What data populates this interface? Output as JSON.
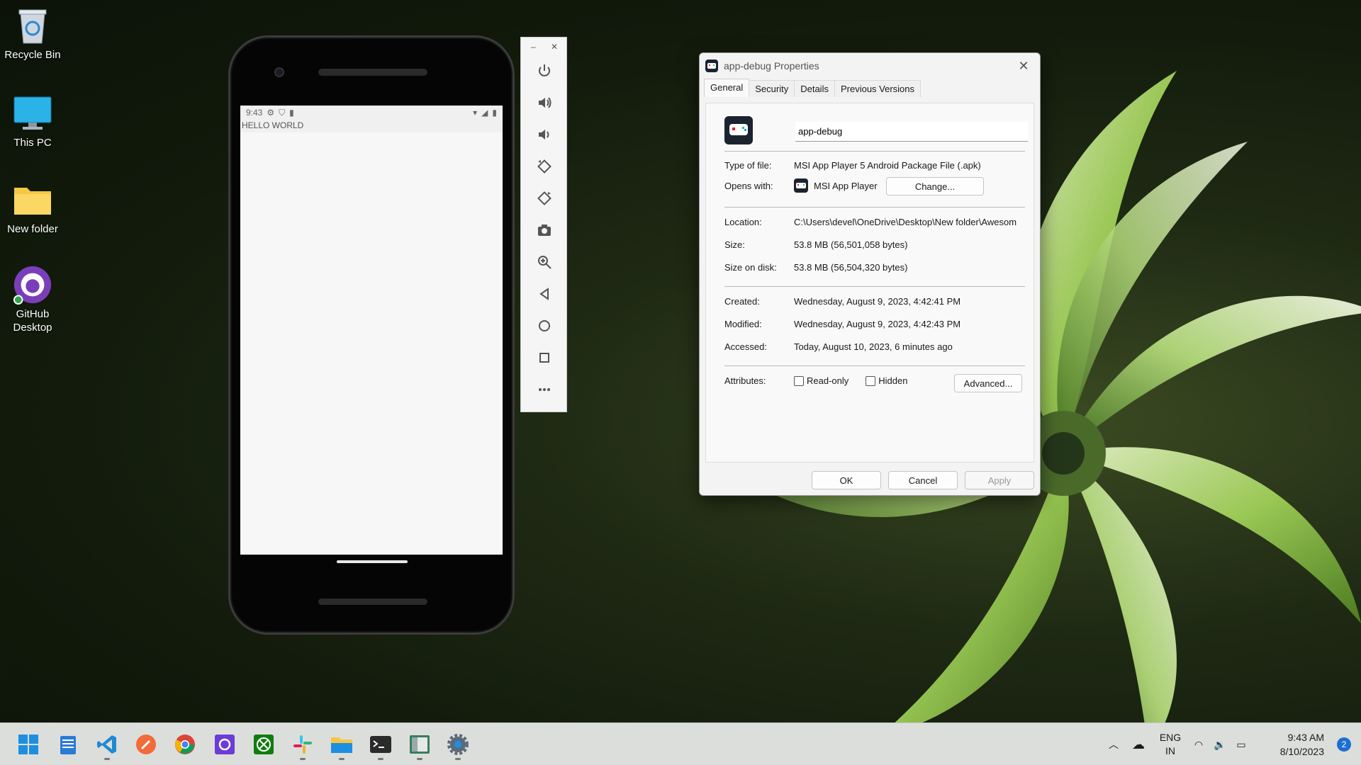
{
  "desktop": {
    "icons": [
      {
        "label": "Recycle Bin"
      },
      {
        "label": "This PC"
      },
      {
        "label": "New folder"
      },
      {
        "label": "GitHub\nDesktop"
      }
    ]
  },
  "phone": {
    "status_time": "9:43",
    "app_text": "HELLO WORLD"
  },
  "emulator_bar": {
    "minimize": "–",
    "close": "✕",
    "buttons": [
      "power",
      "volume-up",
      "volume-down",
      "rotate-left",
      "rotate-right",
      "screenshot",
      "zoom",
      "back",
      "home",
      "overview",
      "more"
    ]
  },
  "dialog": {
    "title": "app-debug Properties",
    "tabs": [
      "General",
      "Security",
      "Details",
      "Previous Versions"
    ],
    "file_name": "app-debug",
    "type_label": "Type of file:",
    "type_value": "MSI App Player 5 Android Package File (.apk)",
    "opens_label": "Opens with:",
    "opens_value": "MSI App Player",
    "change_button": "Change...",
    "location_label": "Location:",
    "location_value": "C:\\Users\\devel\\OneDrive\\Desktop\\New folder\\Awesom",
    "size_label": "Size:",
    "size_value": "53.8 MB (56,501,058 bytes)",
    "size_disk_label": "Size on disk:",
    "size_disk_value": "53.8 MB (56,504,320 bytes)",
    "created_label": "Created:",
    "created_value": "Wednesday, August 9, 2023, 4:42:41 PM",
    "modified_label": "Modified:",
    "modified_value": "Wednesday, August 9, 2023, 4:42:43 PM",
    "accessed_label": "Accessed:",
    "accessed_value": "Today, August 10, 2023, 6 minutes ago",
    "attributes_label": "Attributes:",
    "readonly_label": "Read-only",
    "hidden_label": "Hidden",
    "advanced_button": "Advanced...",
    "ok_button": "OK",
    "cancel_button": "Cancel",
    "apply_button": "Apply"
  },
  "taskbar": {
    "apps": [
      "start",
      "notepad",
      "vscode",
      "postman",
      "chrome",
      "proton",
      "xbox",
      "slack",
      "file-explorer",
      "terminal",
      "emulator",
      "settings"
    ],
    "lang_line1": "ENG",
    "lang_line2": "IN",
    "time": "9:43 AM",
    "date": "8/10/2023",
    "notification_count": "2"
  }
}
